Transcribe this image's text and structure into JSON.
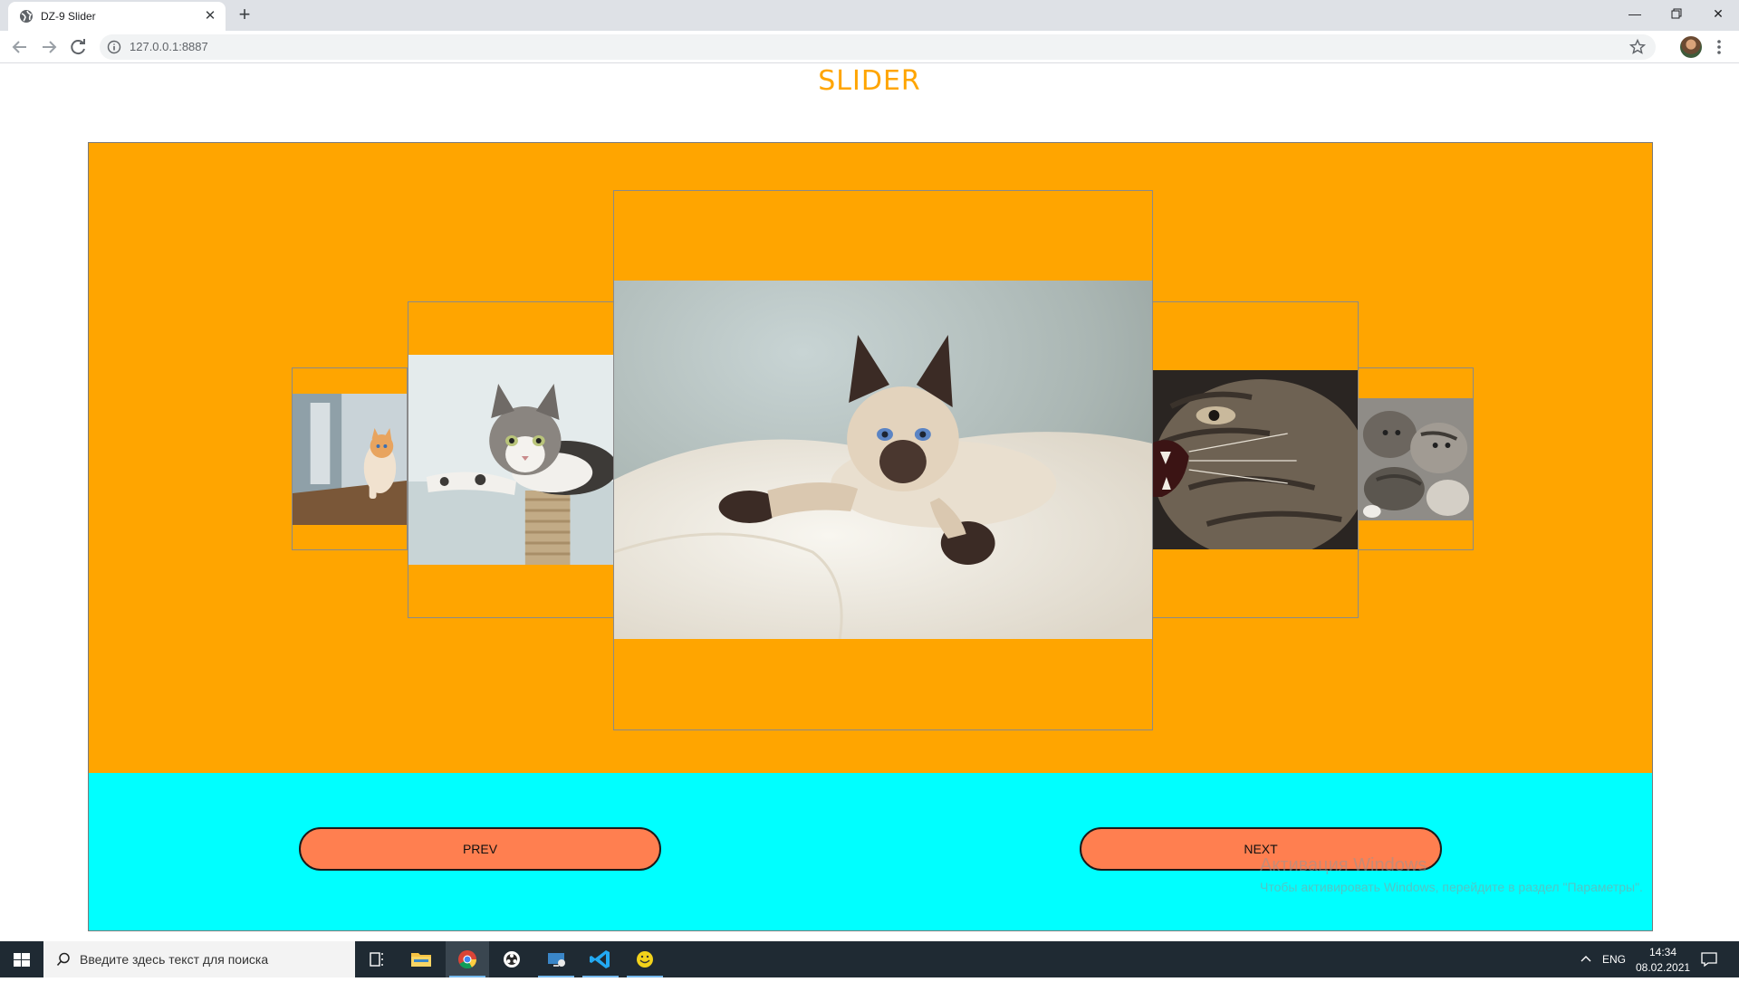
{
  "browser": {
    "tab_title": "DZ-9 Slider",
    "url": "127.0.0.1:8887"
  },
  "page": {
    "title": "SLIDER",
    "slides": [
      {
        "name": "kitten-on-table",
        "tone": "light"
      },
      {
        "name": "tabby-on-scratching-post",
        "tone": "light"
      },
      {
        "name": "siamese-kitten-on-pillow",
        "tone": "light"
      },
      {
        "name": "hissing-tabby-cat",
        "tone": "dark"
      },
      {
        "name": "kittens-playing",
        "tone": "gray"
      }
    ],
    "prev_label": "PREV",
    "next_label": "NEXT"
  },
  "watermark": {
    "line1": "Активация Windows",
    "line2": "Чтобы активировать Windows, перейдите в раздел \"Параметры\"."
  },
  "taskbar": {
    "search_placeholder": "Введите здесь текст для поиска",
    "language": "ENG",
    "time": "14:34",
    "date": "08.02.2021"
  },
  "colors": {
    "stage": "#ffa500",
    "controls": "#00ffff",
    "button": "#ff7f50",
    "title": "#ffa500"
  }
}
